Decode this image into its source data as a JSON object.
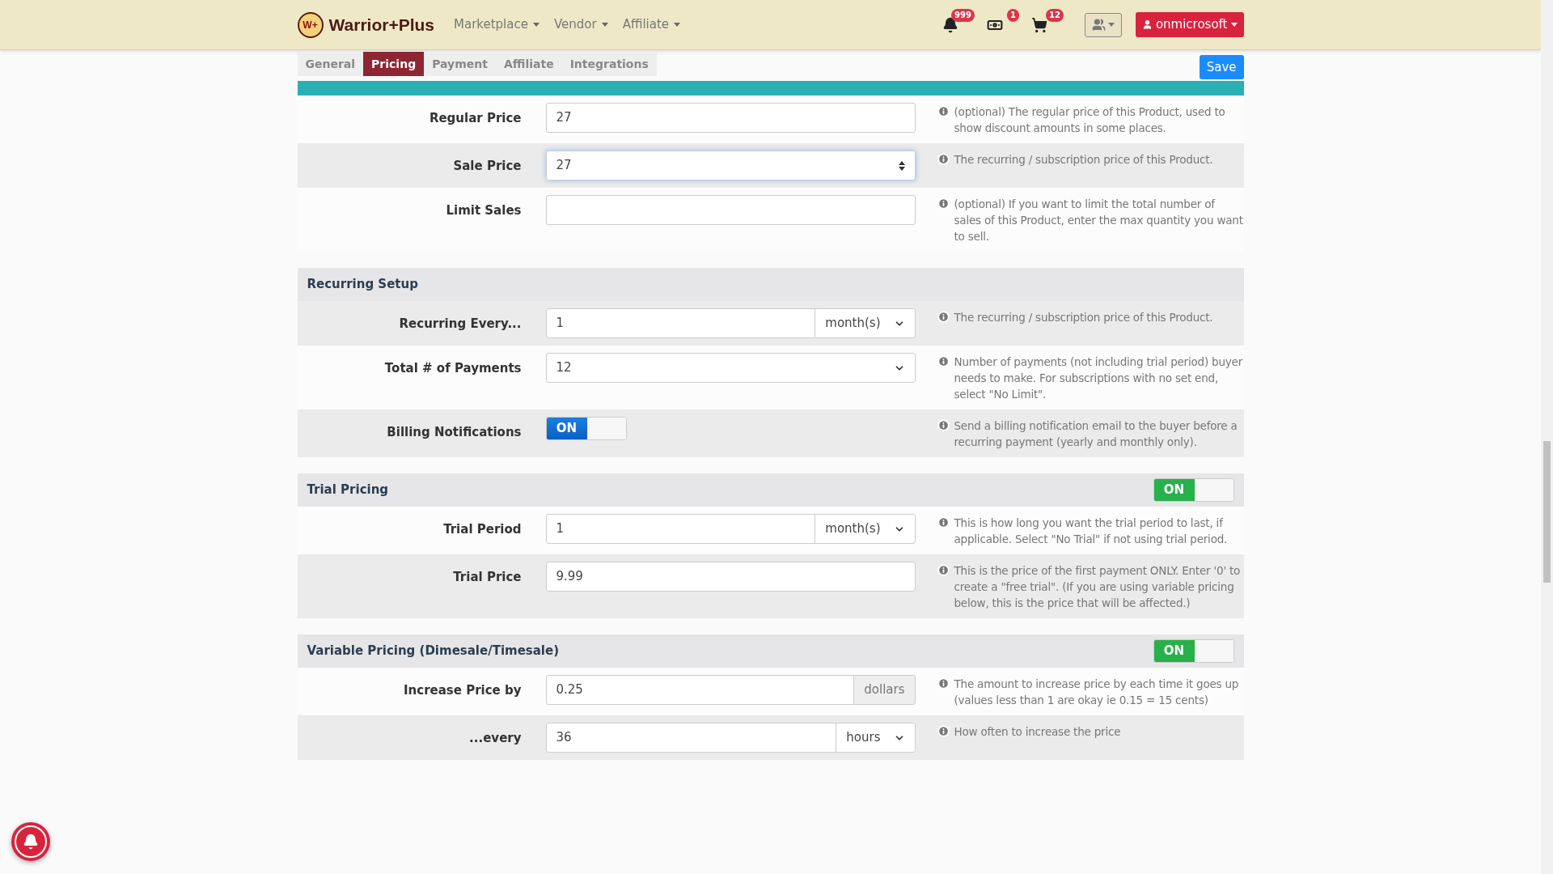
{
  "brand": {
    "logo_text": "W+",
    "name": "Warrior+Plus"
  },
  "nav_menu": [
    {
      "label": "Marketplace"
    },
    {
      "label": "Vendor"
    },
    {
      "label": "Affiliate"
    }
  ],
  "nav_icons": [
    {
      "kind": "bell",
      "badge": "999"
    },
    {
      "kind": "money",
      "badge": "1"
    },
    {
      "kind": "cart",
      "badge": "12"
    }
  ],
  "user_button": {
    "label": "onmicrosoft"
  },
  "tabs": [
    {
      "label": "General",
      "selected": false
    },
    {
      "label": "Pricing",
      "selected": true
    },
    {
      "label": "Payment",
      "selected": false
    },
    {
      "label": "Affiliate",
      "selected": false
    },
    {
      "label": "Integrations",
      "selected": false
    }
  ],
  "save_button": {
    "label": "Save"
  },
  "sections": [
    {
      "rows": [
        {
          "label": "Regular Price",
          "kind": "text",
          "value": "27",
          "shaded": false,
          "help": "(optional) The regular price of this Product, used to show discount amounts in some places."
        },
        {
          "label": "Sale Price",
          "kind": "number",
          "value": "27",
          "focused": true,
          "shaded": true,
          "help": "The recurring / subscription price of this Product."
        },
        {
          "label": "Limit Sales",
          "kind": "text",
          "shaded": false,
          "help": "(optional) If you want to limit the total number of sales of this Product, enter the max quantity you want to sell."
        }
      ]
    },
    {
      "title": "Recurring Setup",
      "rows": [
        {
          "label": "Recurring Every...",
          "kind": "unit",
          "value": "1",
          "unit": "month(s)",
          "shaded": true,
          "help": "The recurring / subscription price of this Product."
        },
        {
          "label": "Total # of Payments",
          "kind": "select",
          "value": "12",
          "shaded": false,
          "help": "Number of payments (not including trial period) buyer needs to make. For subscriptions with no set end, select \"No Limit\"."
        },
        {
          "label": "Billing Notifications",
          "kind": "toggle",
          "on": true,
          "toggle_label": "ON",
          "shaded": true,
          "help": "Send a billing notification email to the buyer before a recurring payment (yearly and monthly only)."
        }
      ]
    },
    {
      "title": "Trial Pricing",
      "toggle": {
        "on": true,
        "label": "ON"
      },
      "rows": [
        {
          "label": "Trial Period",
          "kind": "unit",
          "value": "1",
          "unit": "month(s)",
          "shaded": false,
          "help": "This is how long you want the trial period to last, if applicable. Select \"No Trial\" if not using trial period."
        },
        {
          "label": "Trial Price",
          "kind": "text",
          "value": "9.99",
          "shaded": true,
          "help": "This is the price of the first payment ONLY. Enter '0' to create a \"free trial\". (If you are using variable pricing below, this is the price that will be affected.)"
        }
      ]
    },
    {
      "title": "Variable Pricing (Dimesale/Timesale)",
      "toggle": {
        "on": true,
        "label": "ON"
      },
      "rows": [
        {
          "label": "Increase Price by",
          "kind": "addon",
          "value": "0.25",
          "addon": "dollars",
          "shaded": false,
          "help": "The amount to increase price by each time it goes up (values less than 1 are okay ie 0.15 = 15 cents)"
        },
        {
          "label": "...every",
          "kind": "unit",
          "value": "36",
          "unit": "hours",
          "shaded": true,
          "help": "How often to increase the price"
        }
      ]
    }
  ]
}
